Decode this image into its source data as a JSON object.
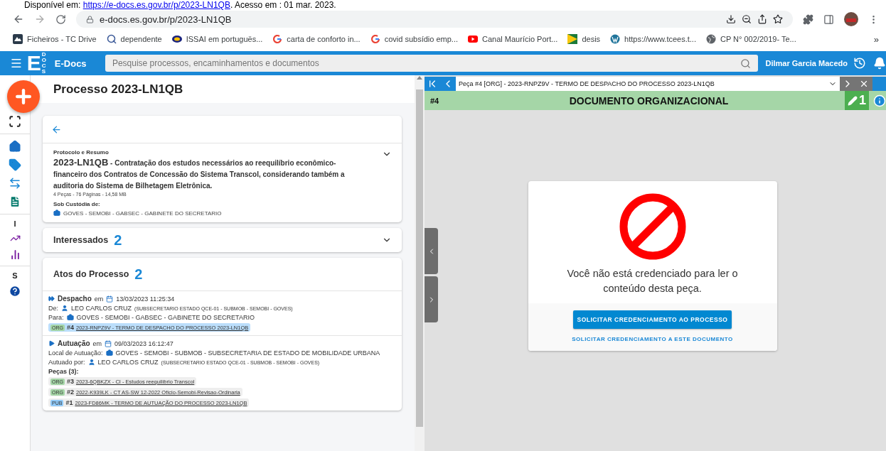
{
  "citation": {
    "prefix": "Disponível em: ",
    "link": "https://e-docs.es.gov.br/p/2023-LN1QB",
    "suffix": ". Acesso em : 01 mar. 2023."
  },
  "browser": {
    "url": "e-docs.es.gov.br/p/2023-LN1QB",
    "overflow": "»",
    "bookmarks": [
      {
        "kind": "drive",
        "label": "Ficheiros - TC Drive"
      },
      {
        "kind": "search",
        "label": "dependente"
      },
      {
        "kind": "tcu",
        "label": "ISSAI em portuguës..."
      },
      {
        "kind": "google",
        "label": "carta de conforto in..."
      },
      {
        "kind": "google",
        "label": "covid subsídio emp..."
      },
      {
        "kind": "youtube",
        "label": "Canal Maurício Port..."
      },
      {
        "kind": "flag",
        "label": "desis"
      },
      {
        "kind": "wordpress",
        "label": "https://www.tcees.t..."
      },
      {
        "kind": "globe",
        "label": "CP N° 002/2019- Te..."
      }
    ]
  },
  "app": {
    "logo_letter": "E",
    "logo_sub": "DOCS",
    "title": "E-Docs",
    "search_placeholder": "Pesquise processos, encaminhamentos e documentos",
    "user": "Dilmar Garcia Macedo"
  },
  "rail": [
    {
      "kind": "fullscreen"
    },
    {
      "kind": "divider"
    },
    {
      "kind": "home"
    },
    {
      "kind": "tag"
    },
    {
      "kind": "swap"
    },
    {
      "kind": "document"
    },
    {
      "kind": "divider"
    },
    {
      "kind": "letter",
      "text": "I"
    },
    {
      "kind": "trend"
    },
    {
      "kind": "bars"
    },
    {
      "kind": "divider"
    },
    {
      "kind": "letter",
      "text": "S"
    },
    {
      "kind": "help"
    }
  ],
  "process": {
    "title": "Processo 2023-LN1QB",
    "summary": {
      "label": "Protocolo e Resumo",
      "code": "2023-LN1QB",
      "text": "- Contratação dos estudos necessários ao reequilíbrio econômico-financeiro dos Contratos de Concessão do Sistema Transcol, considerando também a auditoria do Sistema de Bilhetagem Eletrônica.",
      "stats": "4 Peças - 76 Páginas - 14,58 MB",
      "custody_label": "Sob Custódia de:",
      "custody": "GOVES - SEMOBI - GABSEC - GABINETE DO SECRETARIO"
    },
    "interessados": {
      "label": "Interessados",
      "count": "2"
    },
    "atos": {
      "label": "Atos do Processo",
      "count": "2",
      "items": [
        {
          "kind": "despacho",
          "type": "Despacho",
          "em": "em",
          "date": "13/03/2023 11:25:34",
          "lines": [
            {
              "kind": "person",
              "label": "De:",
              "name": "LEO CARLOS CRUZ",
              "detail": "(SUBSECRETARIO ESTADO QCE-01 - SUBMOB - SEMOBI - GOVES)"
            },
            {
              "kind": "org",
              "label": "Para:",
              "name": "GOVES - SEMOBI - GABSEC - GABINETE DO SECRETARIO"
            }
          ],
          "pieces": [
            {
              "tag": "ORG",
              "color": "#a5d6a7",
              "number": "#4",
              "title": "2023-RNPZ9V - TERMO DE DESPACHO DO PROCESSO 2023-LN1QB",
              "selected": true
            }
          ]
        },
        {
          "kind": "autuacao",
          "type": "Autuação",
          "em": "em",
          "date": "09/03/2023 16:12:47",
          "lines": [
            {
              "kind": "org",
              "label": "Local de Autuação:",
              "name": "GOVES - SEMOBI - SUBMOB - SUBSECRETARIA DE ESTADO DE MOBILIDADE URBANA"
            },
            {
              "kind": "person",
              "label": "Autuado por:",
              "name": "LEO CARLOS CRUZ",
              "detail": "(SUBSECRETARIO ESTADO QCE-01 - SUBMOB - SEMOBI - GOVES)"
            }
          ],
          "pieces_label": "Peças (3):",
          "pieces": [
            {
              "tag": "ORG",
              "color": "#a5d6a7",
              "number": "#3",
              "title": "2023-6QBKZX - CI - Estudos reequilíbrio Transcol",
              "selected": false
            },
            {
              "tag": "ORG",
              "color": "#a5d6a7",
              "number": "#2",
              "title": "2022-K939LK - CT AS-SW 12-2022 Ofício-Semobi-Revisao-Ordinaria",
              "selected": false
            },
            {
              "tag": "PUB",
              "color": "#90caf9",
              "number": "#1",
              "title": "2023-FD86MK - TERMO DE AUTUAÇÃO DO PROCESSO 2023-LN1QB",
              "selected": false
            }
          ]
        }
      ]
    }
  },
  "viewer": {
    "piece_select": "Peça #4 [ORG] - 2023-RNPZ9V - TERMO DE DESPACHO DO PROCESSO 2023-LN1QB",
    "number": "#4",
    "doc_type": "DOCUMENTO ORGANIZACIONAL",
    "edit_count": "1",
    "message": "Você não está credenciado para ler o conteúdo desta peça.",
    "primary_button": "SOLICITAR CREDENCIAMENTO AO PROCESSO",
    "secondary_link": "SOLICITAR CREDENCIAMENTO A ESTE DOCUMENTO"
  }
}
